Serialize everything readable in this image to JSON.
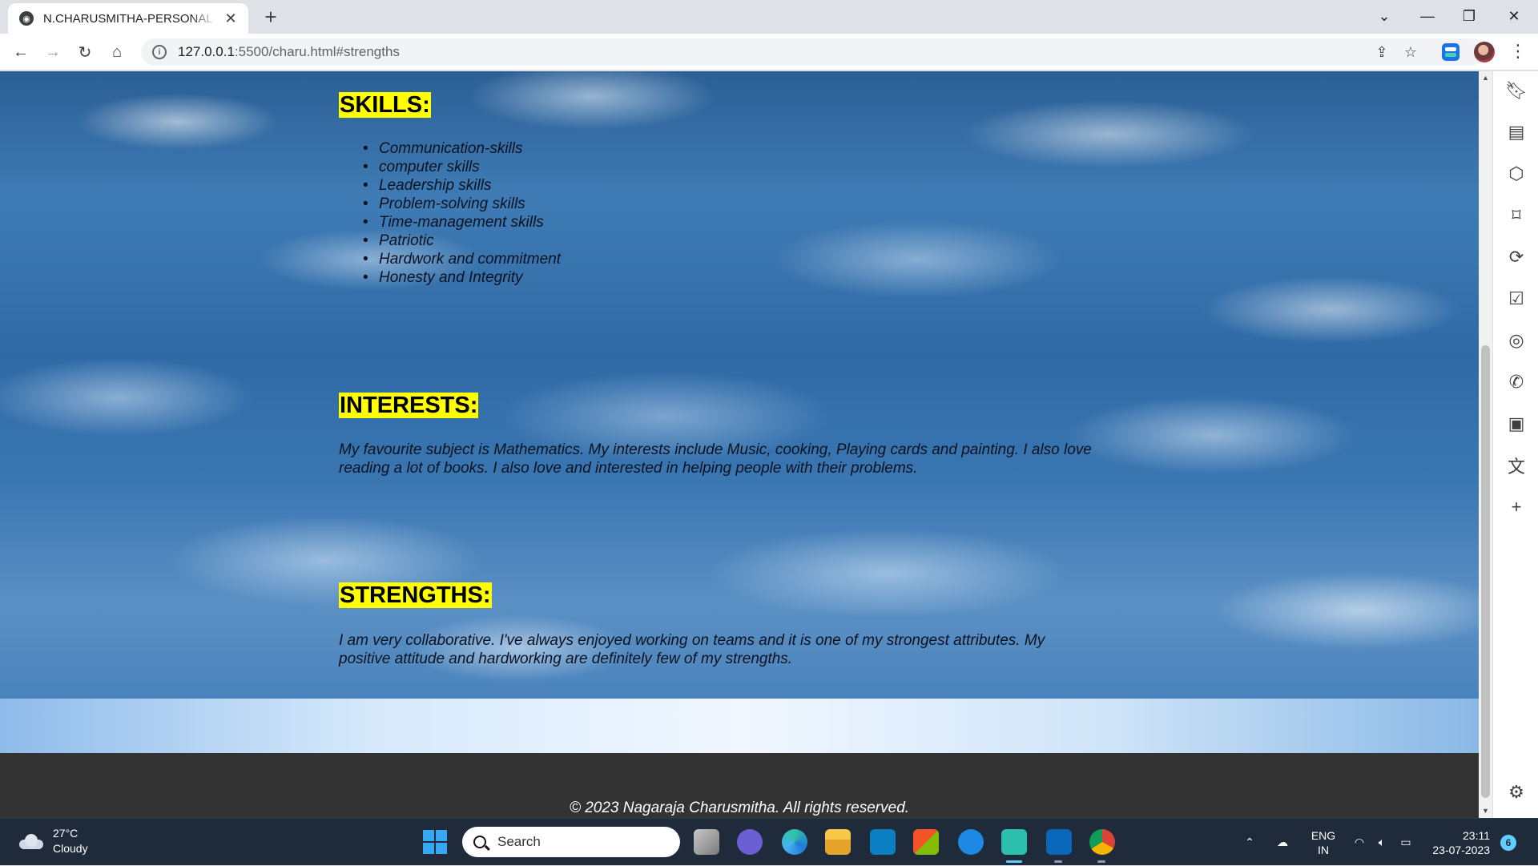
{
  "browser": {
    "tab_title": "N.CHARUSMITHA-PERSONAL WEBSITE",
    "url_host": "127.0.0.1",
    "url_rest": ":5500/charu.html#strengths"
  },
  "page": {
    "skills_heading": "SKILLS:",
    "skills": [
      "Communication-skills",
      "computer skills",
      "Leadership skills",
      "Problem-solving skills",
      "Time-management skills",
      "Patriotic",
      "Hardwork and commitment",
      "Honesty and Integrity"
    ],
    "interests_heading": "INTERESTS:",
    "interests_line1": "My favourite subject is Mathematics. My interests include Music, cooking, Playing cards and painting. I also love",
    "interests_line2": "reading a lot of books. I also love and interested in helping people with their problems.",
    "strengths_heading": "STRENGTHS:",
    "strengths_line1": "I am very collaborative. I've always enjoyed working on teams and it is one of my strongest attributes. My",
    "strengths_line2": "positive attitude and hardworking are definitely few of my strengths.",
    "footer": "© 2023 Nagaraja Charusmitha. All rights reserved."
  },
  "taskbar": {
    "weather_temp": "27°C",
    "weather_desc": "Cloudy",
    "search_label": "Search",
    "lang_1": "ENG",
    "lang_2": "IN",
    "time": "23:11",
    "date": "23-07-2023",
    "notification_count": "6"
  },
  "colors": {
    "heading_highlight": "#ffff00",
    "footer_bg": "#333333",
    "taskbar_bg": "#1f2a3a"
  }
}
